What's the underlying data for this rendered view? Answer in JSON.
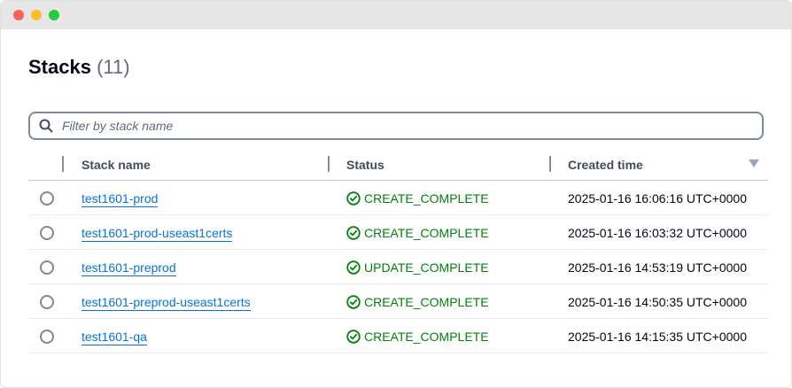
{
  "page": {
    "title": "Stacks",
    "count": "(11)"
  },
  "search": {
    "placeholder": "Filter by stack name",
    "value": ""
  },
  "table": {
    "columns": {
      "name": "Stack name",
      "status": "Status",
      "created": "Created time"
    },
    "rows": [
      {
        "name": "test1601-prod",
        "status": "CREATE_COMPLETE",
        "created": "2025-01-16 16:06:16 UTC+0000"
      },
      {
        "name": "test1601-prod-useast1certs",
        "status": "CREATE_COMPLETE",
        "created": "2025-01-16 16:03:32 UTC+0000"
      },
      {
        "name": "test1601-preprod",
        "status": "UPDATE_COMPLETE",
        "created": "2025-01-16 14:53:19 UTC+0000"
      },
      {
        "name": "test1601-preprod-useast1certs",
        "status": "CREATE_COMPLETE",
        "created": "2025-01-16 14:50:35 UTC+0000"
      },
      {
        "name": "test1601-qa",
        "status": "CREATE_COMPLETE",
        "created": "2025-01-16 14:15:35 UTC+0000"
      }
    ]
  },
  "icons": {
    "search": "search-icon",
    "status": "check-circle-icon",
    "sort": "caret-down-icon"
  },
  "colors": {
    "link": "#0972d3",
    "success": "#037f0c"
  }
}
